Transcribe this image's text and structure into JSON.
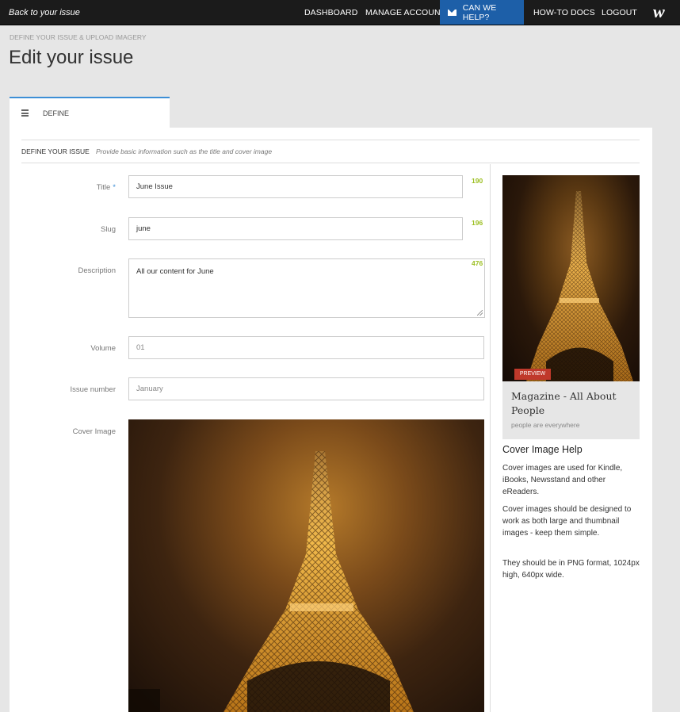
{
  "topbar": {
    "back_link": "Back to your issue",
    "nav": {
      "dashboard": "DASHBOARD",
      "manage_account": "MANAGE ACCOUNT",
      "help": "CAN WE HELP?",
      "docs": "HOW-TO DOCS",
      "logout": "LOGOUT"
    },
    "logo": "w",
    "help_accent": "#1d5fa8"
  },
  "header": {
    "breadcrumb": "DEFINE YOUR ISSUE & UPLOAD IMAGERY",
    "title": "Edit your issue"
  },
  "tab": {
    "label": "DEFINE",
    "icon": "list-icon"
  },
  "section": {
    "title": "DEFINE YOUR ISSUE",
    "description": "Provide basic information such as the title and cover image"
  },
  "form": {
    "title": {
      "label": "Title",
      "required": "*",
      "value": "June Issue",
      "count": "190"
    },
    "slug": {
      "label": "Slug",
      "value": "june",
      "count": "196"
    },
    "description": {
      "label": "Description",
      "value": "All our content for June",
      "count": "476"
    },
    "volume": {
      "label": "Volume",
      "placeholder": "01"
    },
    "issue_number": {
      "label": "Issue number",
      "placeholder": "January"
    },
    "cover_image": {
      "label": "Cover Image"
    }
  },
  "preview": {
    "badge": "PREVIEW",
    "magazine_title": "Magazine - All About People",
    "magazine_subtitle": "people are everywhere"
  },
  "help": {
    "title": "Cover Image Help",
    "paragraphs": [
      "Cover images are used for Kindle, iBooks, Newsstand and other eReaders.",
      "Cover images should be designed to work as both large and thumbnail images - keep them simple.",
      "They should be in PNG format, 1024px high, 640px wide."
    ]
  },
  "colors": {
    "count": "#9cbf22",
    "required": "#3d8fd6",
    "badge": "#c0392b"
  }
}
